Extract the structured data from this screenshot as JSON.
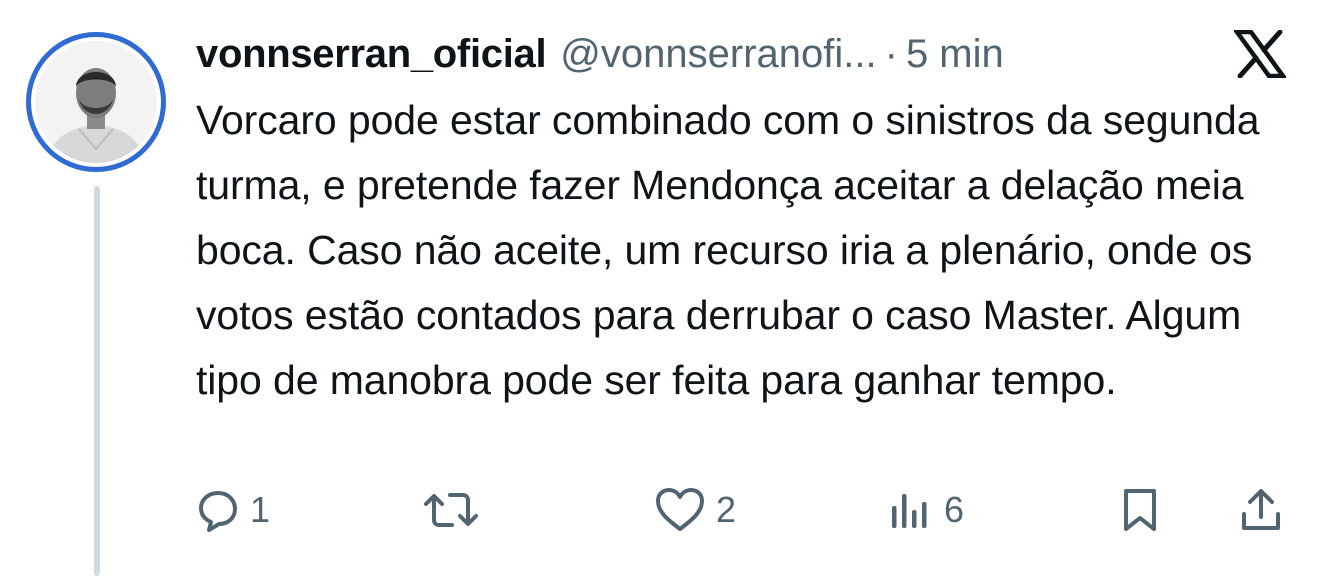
{
  "tweet": {
    "display_name": "vonnserran_oficial",
    "handle": "@vonnserranofi...",
    "separator": "·",
    "time": "5 min",
    "text": "Vorcaro pode estar combinado com o sinistros da segunda turma, e pretende fazer Mendonça aceitar a delação meia boca. Caso não aceite, um recurso iria a plenário, onde os votos estão contados para derrubar o caso Master. Algum tipo de manobra pode ser feita para ganhar tempo."
  },
  "actions": {
    "reply_count": "1",
    "like_count": "2",
    "views_count": "6"
  },
  "icons": {
    "avatar": "avatar-photo",
    "brand": "x-logo-icon",
    "reply": "reply-icon",
    "repost": "repost-icon",
    "like": "heart-icon",
    "views": "views-icon",
    "bookmark": "bookmark-icon",
    "share": "share-icon"
  },
  "colors": {
    "avatar_ring": "#2f6bd3",
    "thread_line": "#cfd9de",
    "secondary_text": "#536471",
    "primary_text": "#0f1419"
  }
}
